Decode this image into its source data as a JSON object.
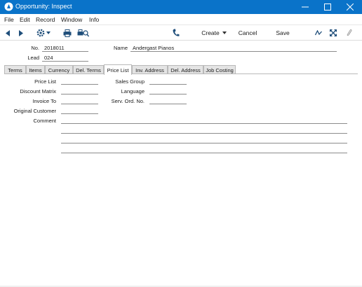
{
  "window": {
    "title": "Opportunity: Inspect"
  },
  "menu": [
    "File",
    "Edit",
    "Record",
    "Window",
    "Info"
  ],
  "toolbar": {
    "create_label": "Create",
    "cancel_label": "Cancel",
    "save_label": "Save"
  },
  "header": {
    "no_label": "No.",
    "no_value": "2018011",
    "name_label": "Name",
    "name_value": "Andergast Pianos",
    "lead_label": "Lead",
    "lead_value": "024"
  },
  "tabs": [
    "Terms",
    "Items",
    "Currency",
    "Del. Terms",
    "Price List",
    "Inv. Address",
    "Del. Address",
    "Job Costing"
  ],
  "active_tab": "Price List",
  "form": {
    "price_list_label": "Price List",
    "discount_matrix_label": "Discount Matrix",
    "invoice_to_label": "Invoice To",
    "original_customer_label": "Original Customer",
    "comment_label": "Comment",
    "sales_group_label": "Sales Group",
    "language_label": "Language",
    "serv_ord_no_label": "Serv. Ord. No."
  },
  "colors": {
    "titlebar": "#0a73c9",
    "toolbar_icon": "#1f4e7a"
  }
}
